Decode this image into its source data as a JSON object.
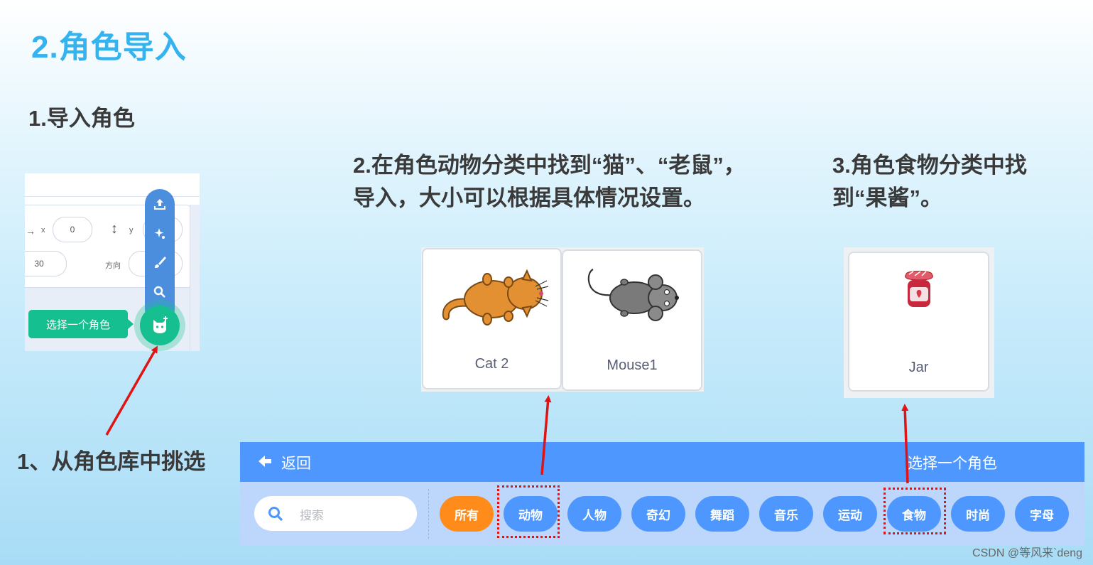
{
  "title": "2.角色导入",
  "step1": "1.导入角色",
  "step2": "2.在角色动物分类中找到“猫”、“老鼠”，导入，大小可以根据具体情况设置。",
  "step3": "3.角色食物分类中找到“果酱”。",
  "note": "1、从角色库中挑选",
  "stage_panel": {
    "x_label": "x",
    "x_value": "0",
    "y_label": "y",
    "size_value": "30",
    "direction_label": "方向",
    "tooltip": "选择一个角色"
  },
  "sprites_animals": [
    {
      "name": "Cat 2"
    },
    {
      "name": "Mouse1"
    }
  ],
  "sprites_food": [
    {
      "name": "Jar"
    }
  ],
  "library": {
    "back_label": "返回",
    "title": "选择一个角色",
    "search_placeholder": "搜索",
    "categories": [
      "所有",
      "动物",
      "人物",
      "奇幻",
      "舞蹈",
      "音乐",
      "运动",
      "食物",
      "时尚",
      "字母"
    ],
    "active_category": "所有"
  },
  "watermark": "CSDN @等风来`deng",
  "colors": {
    "title": "#35b3ee",
    "library_blue": "#4d97ff",
    "active_orange": "#ff8c1a",
    "sprite_green": "#16bf8f",
    "highlight_red": "#e01414"
  }
}
